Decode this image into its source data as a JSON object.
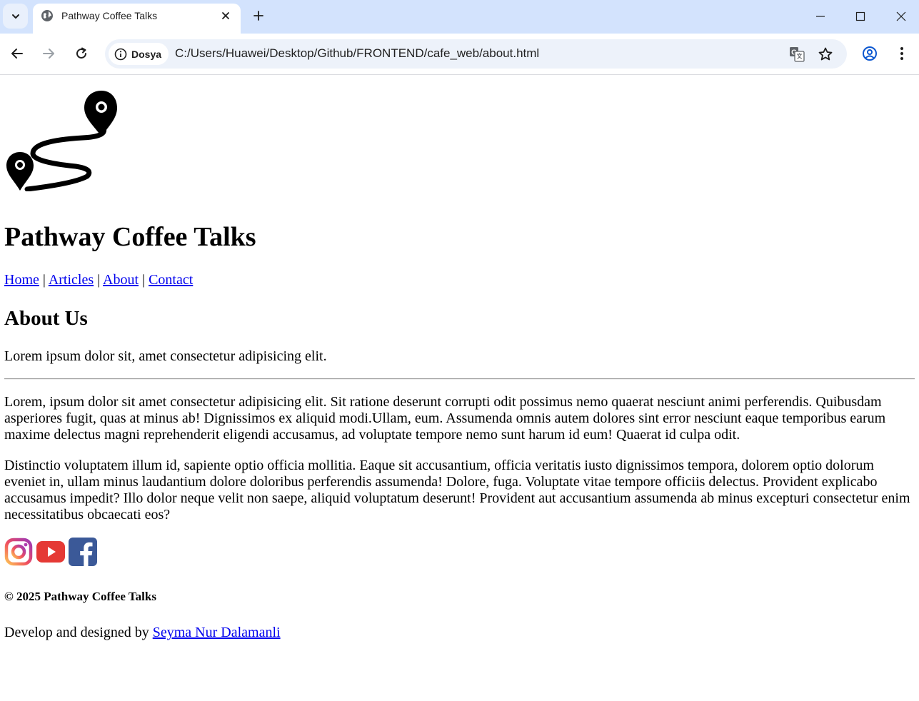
{
  "browser": {
    "tab_title": "Pathway Coffee Talks",
    "site_chip_label": "Dosya",
    "url": "C:/Users/Huawei/Desktop/Github/FRONTEND/cafe_web/about.html",
    "icons": [
      "tab-list-icon",
      "globe-icon",
      "close-icon",
      "plus-icon",
      "minimize-icon",
      "maximize-icon",
      "window-close-icon",
      "back-arrow-icon",
      "forward-arrow-icon",
      "reload-icon",
      "info-icon",
      "translate-icon",
      "star-icon",
      "profile-icon",
      "kebab-menu-icon"
    ]
  },
  "page": {
    "logo_icon": "route-map-pin-icon",
    "site_title": "Pathway Coffee Talks",
    "nav": {
      "home": "Home",
      "articles": "Articles",
      "about": "About",
      "contact": "Contact",
      "separator": "|"
    },
    "about_heading": "About Us",
    "intro": "Lorem ipsum dolor sit, amet consectetur adipisicing elit.",
    "paragraphs": [
      "Lorem, ipsum dolor sit amet consectetur adipisicing elit. Sit ratione deserunt corrupti odit possimus nemo quaerat nesciunt animi perferendis. Quibusdam asperiores fugit, quas at minus ab! Dignissimos ex aliquid modi.Ullam, eum. Assumenda omnis autem dolores sint error nesciunt eaque temporibus earum maxime delectus magni reprehenderit eligendi accusamus, ad voluptate tempore nemo sunt harum id eum! Quaerat id culpa odit.",
      "Distinctio voluptatem illum id, sapiente optio officia mollitia. Eaque sit accusantium, officia veritatis iusto dignissimos tempora, dolorem optio dolorum eveniet in, ullam minus laudantium dolore doloribus perferendis assumenda! Dolore, fuga. Voluptate vitae tempore officiis delectus. Provident explicabo accusamus impedit? Illo dolor neque velit non saepe, aliquid voluptatum deserunt! Provident aut accusantium assumenda ab minus excepturi consectetur enim necessitatibus obcaecati eos?"
    ],
    "social_icons": [
      "instagram-icon",
      "youtube-icon",
      "facebook-icon"
    ],
    "copyright": "© 2025 Pathway Coffee Talks",
    "credit_prefix": "Develop and designed by ",
    "credit_name": "Seyma Nur Dalamanli"
  },
  "colors": {
    "tabbar_bg": "#d3e3fd",
    "omnibox_bg": "#edf2fa",
    "link": "#0000ee",
    "youtube_red": "#e53935",
    "facebook_blue": "#3b5998"
  }
}
